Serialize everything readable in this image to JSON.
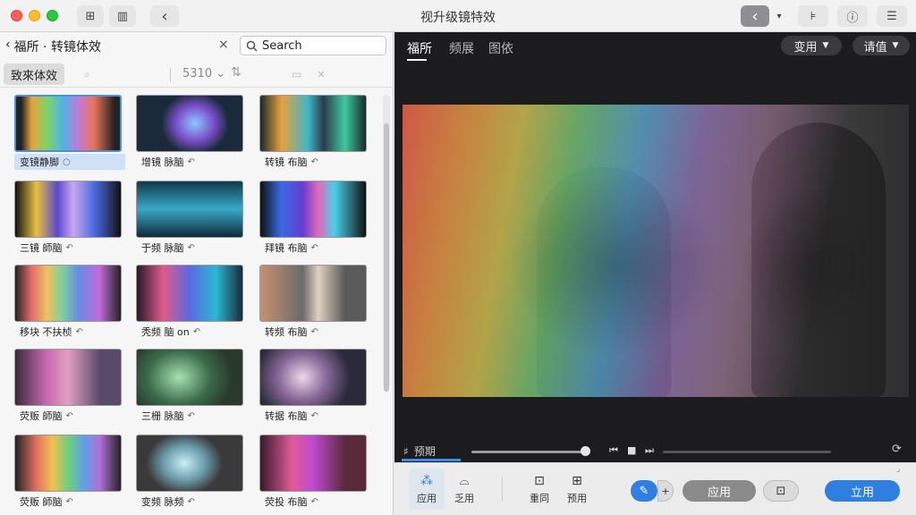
{
  "window": {
    "title": "视升级镜特效",
    "toolbar_left": [
      "⊞",
      "▥",
      "‹"
    ],
    "toolbar_right": [
      "‹",
      "▾",
      "⊧",
      "ⓘ",
      "☰"
    ]
  },
  "left_panel": {
    "back_label": "福所 · 转镜体效",
    "close_icon": "×",
    "search": {
      "placeholder": "Search",
      "value": ""
    },
    "category_tab": "致來体效",
    "count": "5310 ⌄",
    "tiles": [
      {
        "label": "变镜静脚",
        "icon": "○",
        "selected": true
      },
      {
        "label": "增镜 脉脑",
        "icon": "↶"
      },
      {
        "label": "转镜 布脑",
        "icon": "↶"
      },
      {
        "label": "三镜 師脑",
        "icon": "↶"
      },
      {
        "label": "于频 脉脑",
        "icon": "↶"
      },
      {
        "label": "拜镜 布脑",
        "icon": "↶"
      },
      {
        "label": "移块 不扶桢",
        "icon": "↶"
      },
      {
        "label": "秃频 脑 on",
        "icon": "↶"
      },
      {
        "label": "转频 布脑",
        "icon": "↶"
      },
      {
        "label": "荧贩 師脑",
        "icon": "↶"
      },
      {
        "label": "三栅 脉脑",
        "icon": "↶"
      },
      {
        "label": "转据 布脑",
        "icon": "↶"
      },
      {
        "label": "荧贩 師脑",
        "icon": "↶"
      },
      {
        "label": "变频 脉频",
        "icon": "↶"
      },
      {
        "label": "荧投 布脑",
        "icon": "↶"
      }
    ]
  },
  "right_panel": {
    "tabs": [
      "福所",
      "频展",
      "图依"
    ],
    "active_tab": 0,
    "dropdown_apply": "变用",
    "dropdown_settings": "请值",
    "timeline_label": "预期"
  },
  "bottom_toolbar": {
    "items": [
      {
        "icon": "⁂",
        "label": "应用",
        "active": true
      },
      {
        "icon": "⌓",
        "label": "乏用"
      },
      {
        "icon": "⊡",
        "label": "重同"
      },
      {
        "icon": "⊞",
        "label": "预用"
      }
    ],
    "apply_secondary": "应用",
    "apply_primary": "立用",
    "corner_mark": "⌟"
  },
  "colors": {
    "accent": "#2f7fe0",
    "selection": "#cfe1f6",
    "dark_bg": "#1c1c1e"
  }
}
